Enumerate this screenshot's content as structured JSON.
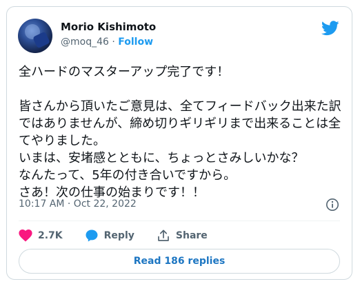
{
  "author": {
    "name": "Morio Kishimoto",
    "handle": "@moq_46",
    "separator": " · ",
    "follow_label": "Follow"
  },
  "tweet": {
    "text": "全ハードのマスターアップ完了です！\n\n皆さんから頂いたご意見は、全てフィードバック出来た訳ではありませんが、締め切りギリギリまで出来ることは全てやりました。\nいまは、安堵感とともに、ちょっとさみしいかな？\nなんたって、5年の付き合いですから。\nさあ！次の仕事の始まりです！！",
    "timestamp": "10:17 AM · Oct 22, 2022"
  },
  "actions": {
    "like_count": "2.7K",
    "reply_label": "Reply",
    "share_label": "Share"
  },
  "footer": {
    "read_replies_label": "Read 186 replies"
  },
  "colors": {
    "accent": "#1d9bf0",
    "like": "#f91880",
    "secondary_text": "#536471"
  },
  "icons": [
    "twitter-logo-icon",
    "info-icon",
    "heart-icon",
    "reply-bubble-icon",
    "share-icon"
  ]
}
